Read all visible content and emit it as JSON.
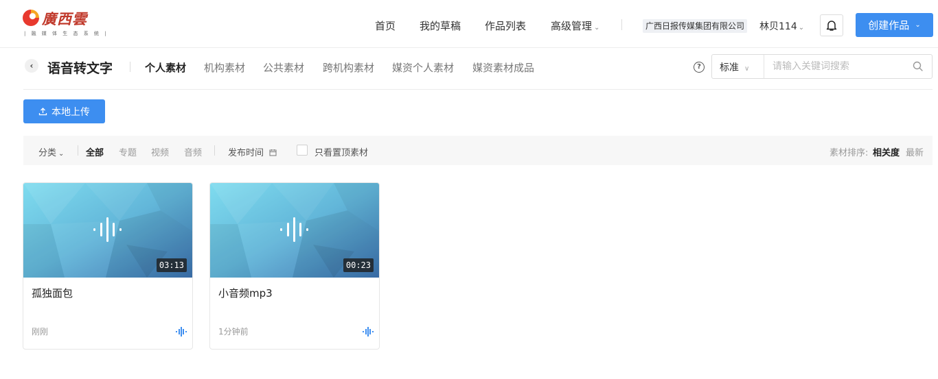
{
  "logo": {
    "text": "廣西雲",
    "subtitle": "| 融 媒 体 生 态 系 统 |"
  },
  "nav": {
    "items": [
      "首页",
      "我的草稿",
      "作品列表",
      "高级管理"
    ],
    "org": "广西日报传媒集团有限公司",
    "user": "林贝114",
    "create_label": "创建作品"
  },
  "subheader": {
    "title": "语音转文字",
    "tabs": [
      "个人素材",
      "机构素材",
      "公共素材",
      "跨机构素材",
      "媒资个人素材",
      "媒资素材成品"
    ],
    "active_tab": "个人素材",
    "search_type": "标准",
    "search_placeholder": "请输入关键词搜索"
  },
  "upload_label": "本地上传",
  "filters": {
    "category_label": "分类",
    "types": [
      "全部",
      "专题",
      "视频",
      "音频"
    ],
    "active_type": "全部",
    "publish_time_label": "发布时间",
    "pinned_only_label": "只看置顶素材",
    "sort_label": "素材排序:",
    "sort_relevance": "相关度",
    "sort_newest": "最新"
  },
  "cards": [
    {
      "title": "孤独面包",
      "duration": "03:13",
      "time": "刚刚",
      "type_icon": "audio-wave-icon"
    },
    {
      "title": "小音频mp3",
      "duration": "00:23",
      "time": "1分钟前",
      "type_icon": "audio-wave-icon"
    }
  ],
  "colors": {
    "primary": "#3d8ef0",
    "logo_red": "#c0392b",
    "thumb_light": "#7fd6ec",
    "thumb_dark": "#3d7ab8"
  }
}
